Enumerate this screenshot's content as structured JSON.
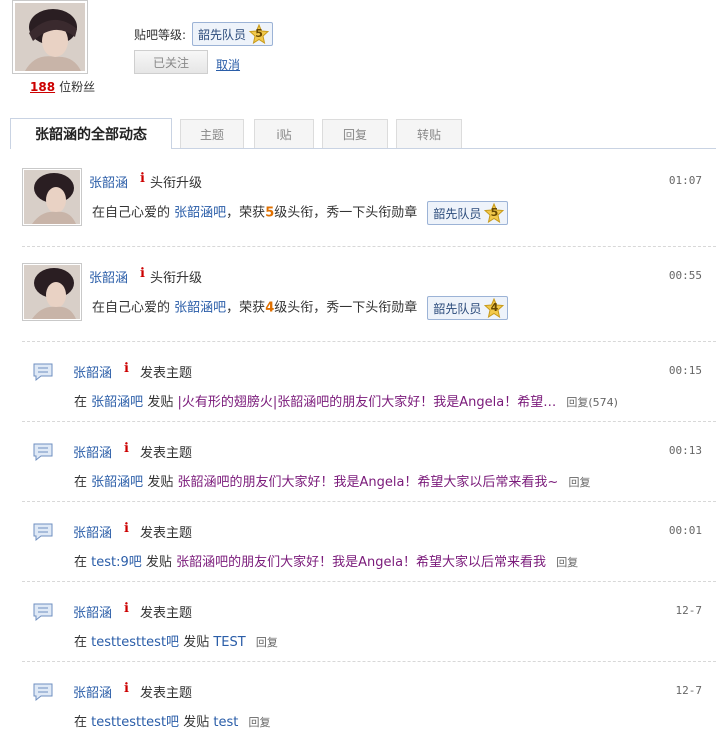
{
  "profile": {
    "level_label": "贴吧等级:",
    "badge_name": "韶先队员",
    "badge_level": "5",
    "follow_button": "已关注",
    "cancel_link": "取消",
    "fans_count": "188",
    "fans_label": "位粉丝"
  },
  "tabs": [
    {
      "label": "张韶涵的全部动态",
      "active": true
    },
    {
      "label": "主题"
    },
    {
      "label": "i贴"
    },
    {
      "label": "回复"
    },
    {
      "label": "转贴"
    }
  ],
  "feed": [
    {
      "type": "levelup",
      "name": "张韶涵",
      "action": "头衔升级",
      "time": "01:07",
      "prefix": "在自己心爱的",
      "bar": "张韶涵吧",
      "mid": "，荣获",
      "level": "5",
      "suffix": "级头衔，秀一下头衔勋章",
      "badge": "韶先队员"
    },
    {
      "type": "levelup",
      "name": "张韶涵",
      "action": "头衔升级",
      "time": "00:55",
      "prefix": "在自己心爱的",
      "bar": "张韶涵吧",
      "mid": "，荣获",
      "level": "4",
      "suffix": "级头衔，秀一下头衔勋章",
      "badge": "韶先队员"
    },
    {
      "type": "post",
      "name": "张韶涵",
      "action": "发表主题",
      "time": "00:15",
      "prefix": "在",
      "bar": "张韶涵吧",
      "verb": "发贴",
      "title": "|火有形的翅膀火|张韶涵吧的朋友们大家好！我是Angela！希望…",
      "reply": "回复(574)"
    },
    {
      "type": "post",
      "name": "张韶涵",
      "action": "发表主题",
      "time": "00:13",
      "prefix": "在",
      "bar": "张韶涵吧",
      "verb": "发贴",
      "title": "张韶涵吧的朋友们大家好！我是Angela！希望大家以后常来看我~",
      "reply": "回复"
    },
    {
      "type": "post",
      "name": "张韶涵",
      "action": "发表主题",
      "time": "00:01",
      "prefix": "在",
      "bar": "test:9吧",
      "verb": "发贴",
      "title": "张韶涵吧的朋友们大家好！我是Angela！希望大家以后常来看我",
      "reply": "回复"
    },
    {
      "type": "post",
      "name": "张韶涵",
      "action": "发表主题",
      "time": "12-7",
      "prefix": "在",
      "bar": "testtesttest吧",
      "verb": "发贴",
      "title": "TEST",
      "reply": "回复"
    },
    {
      "type": "post",
      "name": "张韶涵",
      "action": "发表主题",
      "time": "12-7",
      "prefix": "在",
      "bar": "testtesttest吧",
      "verb": "发贴",
      "title": "test",
      "reply": "回复"
    }
  ],
  "icons": {
    "info": "ℹ",
    "chat": "chat-bubble-icon",
    "star": "star-badge-icon"
  },
  "colors": {
    "link": "#2a5da8",
    "post_title": "#7a1a7a",
    "level_highlight": "#e07000",
    "info_icon": "#c00"
  }
}
